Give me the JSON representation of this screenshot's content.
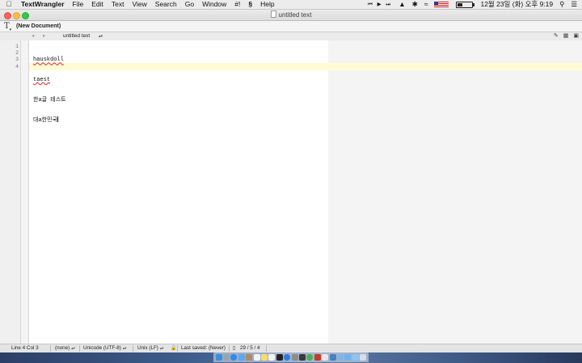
{
  "menubar": {
    "apple_icon": "apple-logo-icon",
    "items": [
      "TextWrangler",
      "File",
      "Edit",
      "Text",
      "View",
      "Search",
      "Go",
      "Window",
      "#!",
      "Help"
    ],
    "script_icon": "script-menu-icon",
    "datetime": "12월 23일 (화) 오후 9:19",
    "status_icons": [
      "media-controls-icon",
      "notification-icon",
      "bluetooth-icon",
      "wifi-icon",
      "us-flag-icon",
      "battery-icon",
      "spotlight-icon",
      "notification-center-icon"
    ],
    "media_glyphs": "⏮ ▶ ⏭"
  },
  "window": {
    "title": "untitled text"
  },
  "toolbar": {
    "doc_state": "(New Document)"
  },
  "navbar": {
    "back": "◂",
    "forward": "▸",
    "document_menu": "untitled text",
    "updown": "▴▾"
  },
  "editor": {
    "line_numbers": [
      "1",
      "2",
      "3",
      "4"
    ],
    "lines": [
      "hauskdoll",
      "taest",
      "한a글 테스트",
      "대a한민국"
    ],
    "current_line": 4
  },
  "statusbar": {
    "position": "Line 4 Col 3",
    "language": "(none)",
    "encoding": "Unicode (UTF-8)",
    "line_endings": "Unix (LF)",
    "last_saved": "Last saved: (Never)",
    "counts": "29 / 5 / 4"
  },
  "colors": {
    "accent": "#34c84a",
    "current_line_highlight": "#fffbd5",
    "close_button": "#fc605c",
    "minimize_button": "#fdbc40",
    "zoom_button": "#34c84a"
  },
  "dock_icons": [
    "finder-icon",
    "launchpad-icon",
    "safari-icon",
    "mail-icon",
    "contacts-icon",
    "calendar-icon",
    "notes-icon",
    "reminders-icon",
    "terminal-icon",
    "app-store-icon",
    "system-preferences-icon",
    "quicktime-icon",
    "chrome-icon",
    "filezilla-icon",
    "textwrangler-icon",
    "xcode-icon",
    "preview-icon",
    "folder-icon",
    "downloads-icon",
    "trash-icon"
  ]
}
